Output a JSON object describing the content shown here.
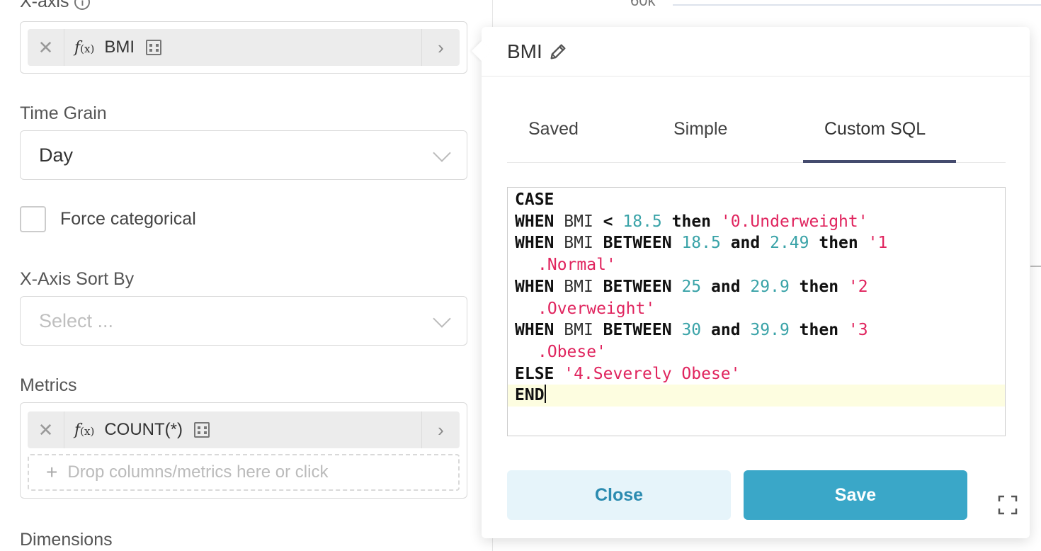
{
  "left_panel": {
    "xaxis_label": "X-axis",
    "xaxis_chip": {
      "fx": "f",
      "fx_sub": "(x)",
      "name": "BMI"
    },
    "time_grain_label": "Time Grain",
    "time_grain_value": "Day",
    "force_categorical_label": "Force categorical",
    "sort_by_label": "X-Axis Sort By",
    "sort_by_placeholder": "Select ...",
    "metrics_label": "Metrics",
    "metric_chip": {
      "fx": "f",
      "fx_sub": "(x)",
      "name": "COUNT(*)"
    },
    "drop_zone_text": "Drop columns/metrics here or click",
    "dimensions_label": "Dimensions"
  },
  "background": {
    "tick_label": "60k"
  },
  "popover": {
    "title": "BMI",
    "tabs": {
      "saved": "Saved",
      "simple": "Simple",
      "custom_sql": "Custom SQL"
    },
    "active_tab": "custom_sql",
    "sql_lines": [
      "CASE",
      "WHEN BMI < 18.5 then '0.Underweight'",
      "WHEN BMI BETWEEN 18.5 and 2.49 then '1",
      ".Normal'",
      "WHEN BMI BETWEEN 25 and 29.9 then '2",
      ".Overweight'",
      "WHEN BMI BETWEEN 30 and 39.9 then '3",
      ".Obese'",
      "ELSE '4.Severely Obese'",
      "END"
    ],
    "close_label": "Close",
    "save_label": "Save"
  }
}
